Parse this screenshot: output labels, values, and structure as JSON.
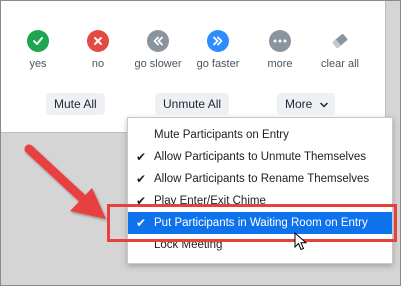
{
  "reactions": [
    {
      "label": "yes",
      "icon": "check-icon",
      "color": "#1ea54f"
    },
    {
      "label": "no",
      "icon": "x-icon",
      "color": "#e24a43"
    },
    {
      "label": "go slower",
      "icon": "rewind-icon",
      "color": "#8a949e"
    },
    {
      "label": "go faster",
      "icon": "fast-forward-icon",
      "color": "#2d8cff"
    },
    {
      "label": "more",
      "icon": "ellipsis-icon",
      "color": "#8a949e"
    },
    {
      "label": "clear all",
      "icon": "eraser-icon",
      "color": "#8a949e"
    }
  ],
  "buttons": {
    "mute_all": "Mute All",
    "unmute_all": "Unmute All",
    "more": "More",
    "more_icon": "chevron-down-icon"
  },
  "menu": {
    "items": [
      {
        "label": "Mute Participants on Entry",
        "checked": false
      },
      {
        "label": "Allow Participants to Unmute Themselves",
        "checked": true
      },
      {
        "label": "Allow Participants to Rename Themselves",
        "checked": true
      },
      {
        "label": "Play Enter/Exit Chime",
        "checked": true
      },
      {
        "label": "Put Participants in Waiting Room on Entry",
        "checked": true,
        "highlighted": true
      },
      {
        "label": "Lock Meeting",
        "checked": false
      }
    ]
  },
  "colors": {
    "annotation_red": "#e8403f",
    "selection_blue": "#0e72ed"
  }
}
